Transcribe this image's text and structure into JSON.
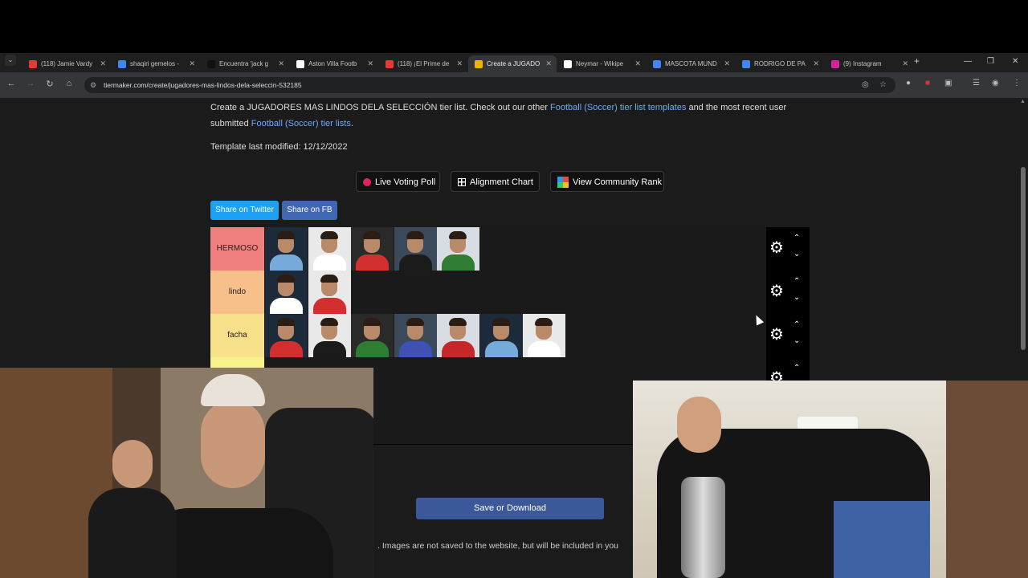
{
  "browser": {
    "tabs": [
      {
        "label": "(118) Jamie Vardy",
        "color": "#e53935",
        "active": false
      },
      {
        "label": "shaqiri gemelos -",
        "color": "#4285f4",
        "active": false
      },
      {
        "label": "Encuentra 'jack g",
        "color": "#111111",
        "active": false
      },
      {
        "label": "Aston Villa Footb",
        "color": "#ffffff",
        "active": false
      },
      {
        "label": "(118) ¡El Prime de",
        "color": "#e53935",
        "active": false
      },
      {
        "label": "Create a JUGADO",
        "color": "#f4b400",
        "active": true
      },
      {
        "label": "Neymar - Wikipe",
        "color": "#ffffff",
        "active": false
      },
      {
        "label": "MASCOTA MUND",
        "color": "#4285f4",
        "active": false
      },
      {
        "label": "RODRIGO DE PA",
        "color": "#4285f4",
        "active": false
      },
      {
        "label": "(9) Instagram",
        "color": "#d6249f",
        "active": false
      }
    ],
    "new_tab": "+",
    "url": "tiermaker.com/create/jugadores-mas-lindos-dela-seleccin-532185"
  },
  "page": {
    "desc_1": "Create a JUGADORES MAS LINDOS DELA SELECCIÓN tier list. Check out our other ",
    "desc_link_1": "Football (Soccer) tier list templates",
    "desc_2": " and the most recent user submitted ",
    "desc_link_2": "Football (Soccer) tier lists",
    "desc_3": ".",
    "modified": "Template last modified: 12/12/2022",
    "buttons": {
      "live_poll": "Live Voting Poll",
      "alignment": "Alignment Chart",
      "community": "View Community Rank"
    },
    "share_twitter": "Share on Twitter",
    "share_fb": "Share on FB",
    "tiers": [
      {
        "label": "HERMOSO",
        "color": "#f08080",
        "count": 5
      },
      {
        "label": "lindo",
        "color": "#f7c08a",
        "count": 2
      },
      {
        "label": "facha",
        "color": "#f7e08a",
        "count": 7
      },
      {
        "label": "",
        "color": "#f7f28a",
        "count": 0
      },
      {
        "label": "",
        "color": "#c8f08a",
        "count": 0
      }
    ],
    "save": "Save or Download",
    "note": ". Images are not saved to the website, but will be included in you"
  }
}
